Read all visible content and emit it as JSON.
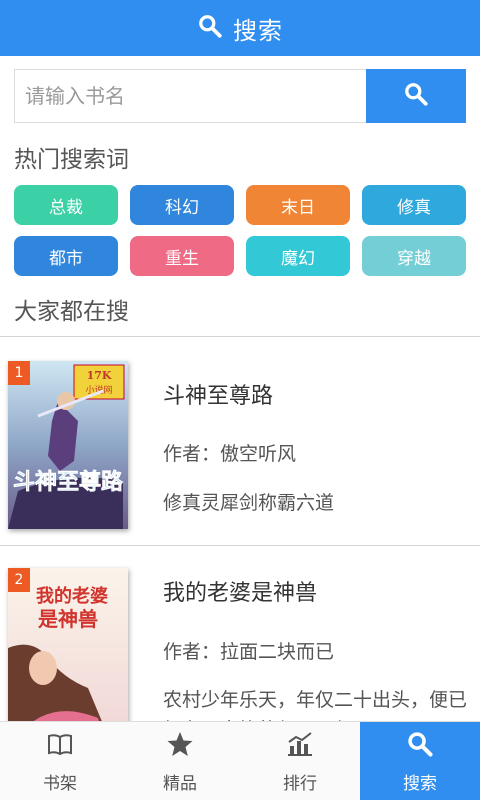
{
  "header": {
    "title": "搜索",
    "icon": "search-icon"
  },
  "search": {
    "placeholder": "请输入书名",
    "value": "",
    "button_icon": "search-icon"
  },
  "hot": {
    "title": "热门搜索词",
    "tags": [
      {
        "label": "总裁",
        "color": "#3bd0a6"
      },
      {
        "label": "科幻",
        "color": "#2f86dc"
      },
      {
        "label": "末日",
        "color": "#ef8535"
      },
      {
        "label": "修真",
        "color": "#2fa8de"
      },
      {
        "label": "都市",
        "color": "#2f86dc"
      },
      {
        "label": "重生",
        "color": "#ef6a84"
      },
      {
        "label": "魔幻",
        "color": "#33c8d6"
      },
      {
        "label": "穿越",
        "color": "#74ced6"
      }
    ]
  },
  "popular": {
    "title": "大家都在搜",
    "books": [
      {
        "rank": "1",
        "title": "斗神至尊路",
        "author": "作者：傲空听风",
        "desc": "修真灵犀剑称霸六道",
        "cover_text": "17K小说网"
      },
      {
        "rank": "2",
        "title": "我的老婆是神兽",
        "author": "作者：拉面二块而已",
        "desc": "农村少年乐天，年仅二十出头，便已经有了家族的保母，但"
      }
    ]
  },
  "nav": {
    "items": [
      {
        "label": "书架",
        "icon": "book-icon"
      },
      {
        "label": "精品",
        "icon": "star-icon"
      },
      {
        "label": "排行",
        "icon": "chart-icon"
      },
      {
        "label": "搜索",
        "icon": "search-icon",
        "active": true
      }
    ]
  }
}
